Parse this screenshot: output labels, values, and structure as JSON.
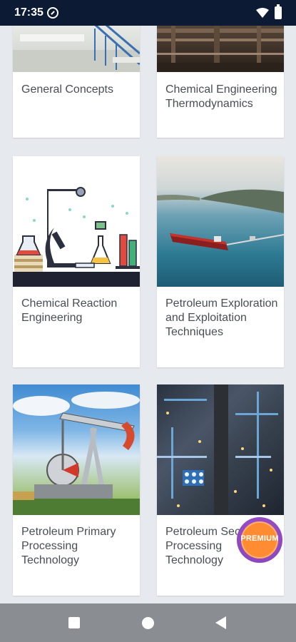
{
  "status_bar": {
    "time": "17:35",
    "icons": [
      "do-not-disturb-icon",
      "wifi-icon",
      "battery-icon"
    ]
  },
  "cards": [
    {
      "title": "General Concepts",
      "image": "industrial-stairs-photo"
    },
    {
      "title": "Chemical Engineering Thermodynamics",
      "image": "industrial-pipes-photo"
    },
    {
      "title": "Chemical Reaction Engineering",
      "image": "laboratory-illustration"
    },
    {
      "title": "Petroleum Exploration and Exploitation Techniques",
      "image": "oil-tanker-photo"
    },
    {
      "title": "Petroleum Primary Processing Technology",
      "image": "oil-pump-jack-photo"
    },
    {
      "title": "Petroleum Secondary Processing Technology",
      "image": "refinery-aerial-photo"
    }
  ],
  "premium_badge": {
    "label": "PREMIUM",
    "colors": {
      "outer": "#7a3bb0",
      "inner": "#ff8c33"
    }
  },
  "nav_bar": {
    "buttons": [
      "recents-button",
      "home-button",
      "back-button"
    ]
  },
  "colors": {
    "status_bar": "#0c1b33",
    "background": "#e6e9ee",
    "card": "#ffffff",
    "title_text": "#4a4d52",
    "nav_bar": "#8a8d91"
  }
}
